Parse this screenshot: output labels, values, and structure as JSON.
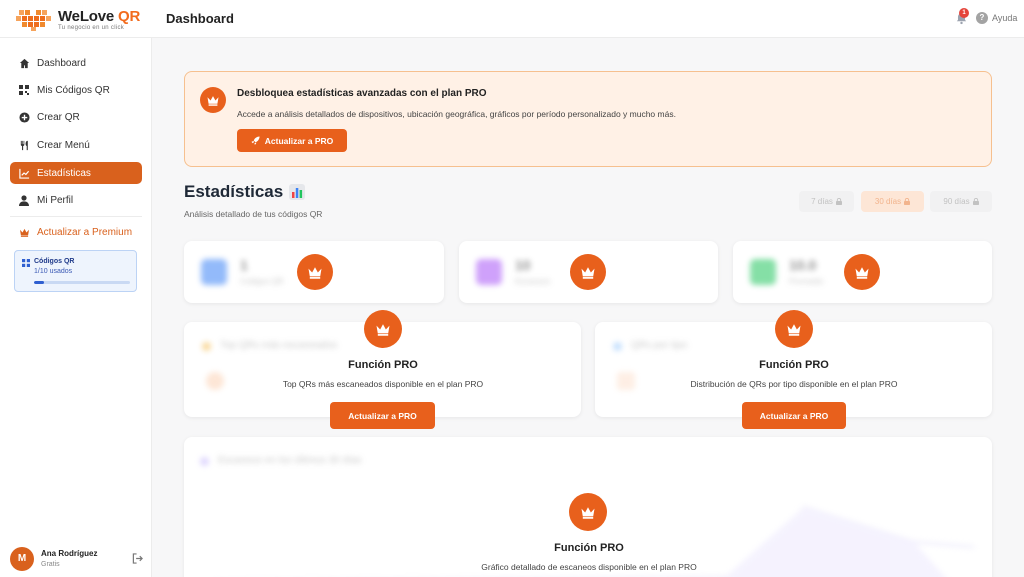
{
  "brand": {
    "name_part1": "WeLove ",
    "name_part2": "QR",
    "tagline": "Tu negocio en un click",
    "accent": "#e8601c"
  },
  "header": {
    "title": "Dashboard",
    "notifications": "1",
    "help_label": "Ayuda"
  },
  "sidebar": {
    "items": [
      {
        "label": "Dashboard",
        "icon": "home-icon"
      },
      {
        "label": "Mis Códigos QR",
        "icon": "qr-grid-icon"
      },
      {
        "label": "Crear QR",
        "icon": "plus-circle-icon"
      },
      {
        "label": "Crear Menú",
        "icon": "utensils-icon"
      },
      {
        "label": "Estadísticas",
        "icon": "chart-line-icon"
      },
      {
        "label": "Mi Perfil",
        "icon": "user-icon"
      }
    ],
    "active": "Estadísticas",
    "premium_label": "Actualizar a Premium",
    "usage": {
      "title": "Códigos QR",
      "count": "1/10 usados",
      "fraction": 0.1
    },
    "user": {
      "initial": "M",
      "name": "Ana Rodríguez",
      "plan": "Gratis"
    }
  },
  "banner": {
    "title": "Desbloquea estadísticas avanzadas con el plan PRO",
    "description": "Accede a análisis detallados de dispositivos, ubicación geográfica, gráficos por período personalizado y mucho más.",
    "button": "Actualizar a PRO"
  },
  "stats": {
    "title": "Estadísticas",
    "subtitle": "Análisis detallado de tus códigos QR",
    "ranges": [
      "7 días",
      "30 días",
      "90 días"
    ],
    "active_range": "30 días",
    "cards": [
      {
        "value": "1",
        "label": "Códigos QR",
        "color": "#3b82f6"
      },
      {
        "value": "10",
        "label": "Escaneos",
        "color": "#a855f7"
      },
      {
        "value": "10.0",
        "label": "Promedio",
        "color": "#22c55e"
      }
    ]
  },
  "pro_panels": [
    {
      "blurred_title": "Top QRs más escaneados",
      "title": "Función PRO",
      "description": "Top QRs más escaneados disponible en el plan PRO",
      "button": "Actualizar a PRO"
    },
    {
      "blurred_title": "QRs por tipo",
      "title": "Función PRO",
      "description": "Distribución de QRs por tipo disponible en el plan PRO",
      "button": "Actualizar a PRO"
    }
  ],
  "chart_panel": {
    "blurred_title": "Escaneos en los últimos 30 días",
    "title": "Función PRO",
    "description": "Gráfico detallado de escaneos disponible en el plan PRO"
  }
}
